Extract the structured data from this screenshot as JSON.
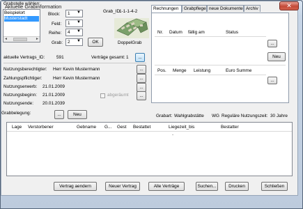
{
  "window": {
    "title": "Aktuelle Grabinformation",
    "close_glyph": "✕"
  },
  "selection": {
    "legend": "Grabstelle wählen:",
    "fields": [
      "Beispielort",
      "Musterstadt"
    ],
    "scroll_left": "◄",
    "scroll_right": "►",
    "block_label": "Block:",
    "block_value": "1",
    "feld_label": "Feld:",
    "feld_value": "1",
    "reihe_label": "Reihe:",
    "reihe_value": "4",
    "grab_label": "Grab:",
    "grab_value": "2",
    "ok_label": "OK",
    "arrow": "▼"
  },
  "grave": {
    "id_label": "Grab_ID:",
    "id_value": "1-1-1-4-2",
    "image_caption": "DoppelGrab"
  },
  "contract": {
    "vertrag_label": "aktuelle Vertrags_ID:",
    "vertrag_value": "591",
    "total_label": "Verträge gesamt:",
    "total_value": "1",
    "dots": "...",
    "nutz_label": "Nutzungsberechtigter:",
    "nutz_value": "Herr  Kevin Mustermann",
    "zahl_label": "Zahlungspflichtiger:",
    "zahl_value": "Herr  Kevin Mustermann",
    "erwerb_label": "Nutzungserwerb:",
    "erwerb_value": "21.01.2009",
    "beginn_label": "Nutzungsbeginn:",
    "beginn_value": "21.01.2009",
    "ende_label": "Nutzungsende:",
    "ende_value": "20.01.2039",
    "abgeraeumt_label": "abgeräumt"
  },
  "tabs": [
    "Rechnungen",
    "Grabpflege",
    "neue Dokumente",
    "Archiv"
  ],
  "rechnungen": {
    "columns": [
      "Nr.",
      "Datum",
      "fällig am",
      "Status"
    ],
    "neu_label": "Neu",
    "positions_columns": [
      "Pos.",
      "Menge",
      "Leistung",
      "Euro Summe"
    ]
  },
  "belegung": {
    "label": "Grabbelegung:",
    "neu_label": "Neu",
    "grabart_label": "Grabart:",
    "grabart_value": "Wahlgrabstätte",
    "wg_label": "WG",
    "ruhezeit_label": "Reguläre Nutzungszeit:",
    "ruhezeit_value": "30 Jahre",
    "columns": [
      "Lage",
      "Verstorbener",
      "Geburtsname",
      "G...",
      "Gest",
      "Bestattet",
      "Liegezeit_bis",
      "Bestatter"
    ],
    "visible_columns": [
      "Lage",
      "Verstorbener",
      "Gebname",
      "G...",
      "Gest",
      "Bestattet",
      "Liegezeit_bis",
      "Bestatter"
    ],
    "empty_dot": "-"
  },
  "footer": {
    "aendern": "Vertrag aendern",
    "neuer": "Neuer Vertrag",
    "alle": "Alle Verträge",
    "suchen": "Suchen...",
    "drucken": "Drucken",
    "schliessen": "Schließen"
  },
  "colors": {
    "selected_row": "#3399ff",
    "accent_button": "#bfe0f8"
  }
}
